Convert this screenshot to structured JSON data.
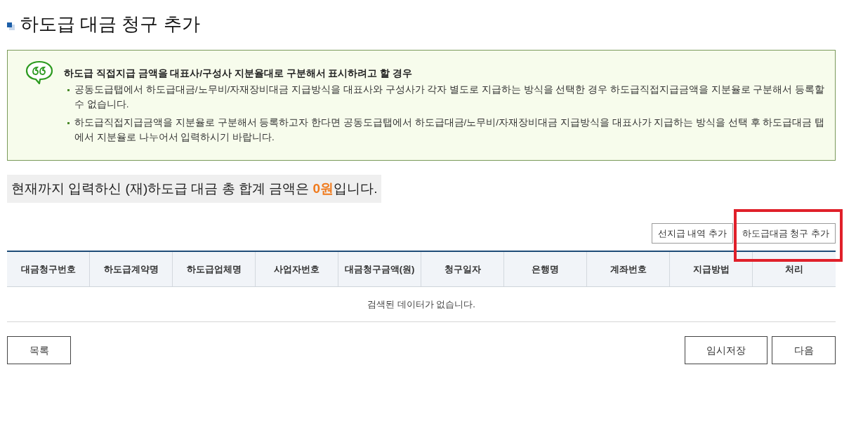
{
  "page": {
    "title": "하도급 대금 청구 추가"
  },
  "notice": {
    "heading": "하도급 직접지급 금액을 대표사/구성사 지분율대로 구분해서 표시하려고 할 경우",
    "items": [
      "공동도급탭에서 하도급대금/노무비/자재장비대금 지급방식을 대표사와 구성사가 각자 별도로 지급하는 방식을 선택한 경우 하도급직접지급금액을 지분율로 구분해서 등록할 수 없습니다.",
      "하도급직접지급금액을 지분율로 구분해서 등록하고자 한다면 공동도급탭에서 하도급대금/노무비/자재장비대금 지급방식을 대표사가 지급하는 방식을 선택 후 하도급대금 탭에서 지분율로 나누어서 입력하시기 바랍니다."
    ]
  },
  "total": {
    "prefix": "현재까지 입력하신 (재)하도급 대금 총 합계 금액은 ",
    "amount": "0원",
    "suffix": "입니다."
  },
  "table_actions": [
    {
      "label": "선지급 내역 추가",
      "highlighted": false
    },
    {
      "label": "하도급대금 청구 추가",
      "highlighted": true
    }
  ],
  "table": {
    "columns": [
      "대금청구번호",
      "하도급계약명",
      "하도급업체명",
      "사업자번호",
      "대금청구금액(원)",
      "청구일자",
      "은행명",
      "계좌번호",
      "지급방법",
      "처리"
    ],
    "empty_message": "검색된 데이터가 없습니다."
  },
  "footer": {
    "left_buttons": [
      "목록"
    ],
    "right_buttons": [
      "임시저장",
      "다음"
    ]
  }
}
